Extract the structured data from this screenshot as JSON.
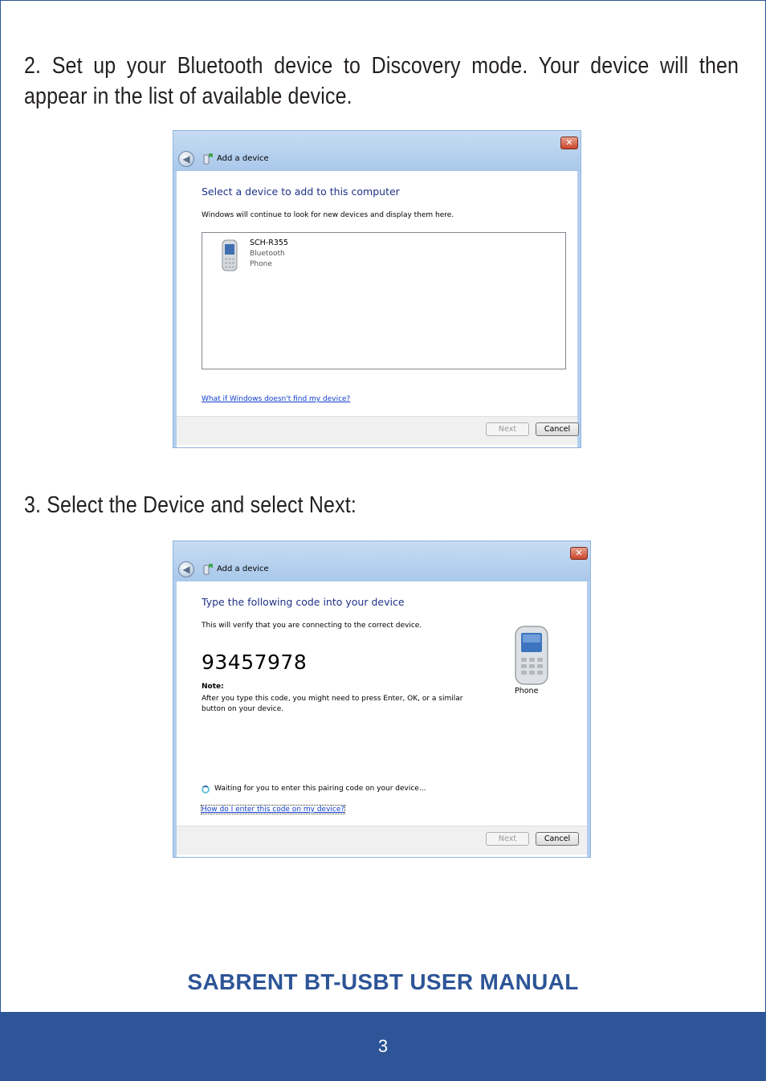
{
  "steps": [
    {
      "text": "2. Set up your Bluetooth device to Discovery mode. Your device will then appear in the list of available device."
    },
    {
      "text": "3. Select the Device and select Next:"
    }
  ],
  "dialog1": {
    "title": "Add a device",
    "heading": "Select a device to add to this computer",
    "subtext": "Windows will continue to look for new devices and display them here.",
    "device": {
      "name": "SCH-R355",
      "type": "Bluetooth",
      "category": "Phone",
      "icon": "mobile-phone-icon"
    },
    "link": "What if Windows doesn't find my device?",
    "next_label": "Next",
    "cancel_label": "Cancel"
  },
  "dialog2": {
    "title": "Add a device",
    "heading": "Type the following code into your device",
    "subtext": "This will verify that you are connecting to the correct device.",
    "code": "93457978",
    "note_label": "Note:",
    "note_text": "After you type this code, you might need to press Enter, OK, or a similar button on your device.",
    "phone_label": "Phone",
    "waiting_text": "Waiting for you to enter this pairing code on your device...",
    "link": "How do I enter this code on my device?",
    "next_label": "Next",
    "cancel_label": "Cancel"
  },
  "footer": {
    "manual_title": "SABRENT BT-USBT USER MANUAL",
    "page_number": "3"
  },
  "colors": {
    "brand_blue": "#2d5597",
    "link_blue": "#0f3ecc",
    "heading_blue": "#1e3287"
  }
}
